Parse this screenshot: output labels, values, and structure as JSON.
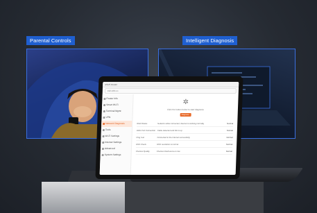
{
  "headers": {
    "left": "Parental Controls",
    "right": "Intelligent Diagnosis"
  },
  "app": {
    "title_bar": "ASUS Router",
    "address": "192.168.1.1",
    "sidebar": [
      {
        "label": "Router Info"
      },
      {
        "label": "Smart Wi-Fi"
      },
      {
        "label": "Terminal Mgmt"
      },
      {
        "label": "VPN"
      },
      {
        "label": "Network Diagnosis",
        "active": true
      },
      {
        "label": "Tools"
      },
      {
        "label": "Wi-Fi Settings"
      },
      {
        "label": "Internet Settings"
      },
      {
        "label": "Advanced"
      },
      {
        "label": "System Settings"
      }
    ],
    "main": {
      "description": "Click the button below to start diagnosis",
      "button": "Diagnose",
      "rows": [
        {
          "item": "WAN Status",
          "detail": "Network cable connected, internet is working normally",
          "status": "Normal"
        },
        {
          "item": "WAN Port Connection",
          "detail": "Cable detected and link is up",
          "status": "Normal"
        },
        {
          "item": "Ping Test",
          "detail": "Connected to the internet successfully",
          "status": "Normal"
        },
        {
          "item": "DNS Check",
          "detail": "DNS resolution is normal",
          "status": "Normal"
        },
        {
          "item": "Channel Quality",
          "detail": "Channel interference is low",
          "status": "Normal"
        }
      ]
    }
  },
  "colors": {
    "accent": "#e86a2a",
    "tag": "#1f5fd0"
  }
}
